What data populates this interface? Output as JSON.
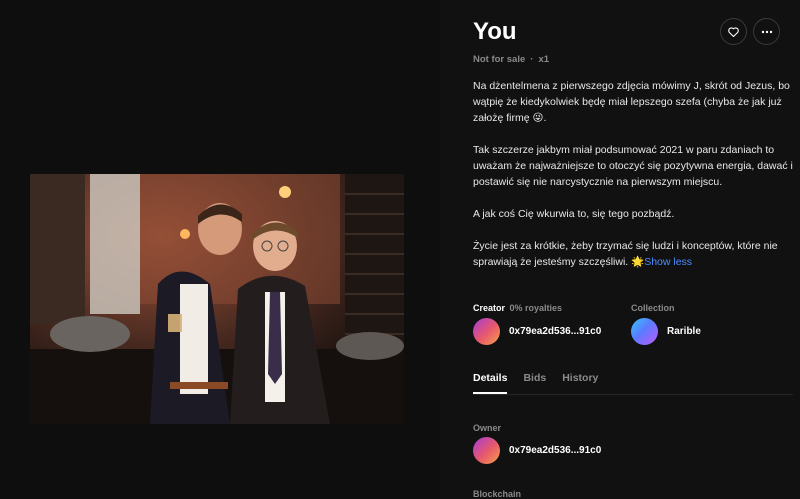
{
  "item": {
    "title": "You",
    "sale_status": "Not for sale",
    "edition": "x1",
    "description": [
      "Na dżentelmena z pierwszego zdjęcia mówimy J, skrót od Jezus, bo wątpię że kiedykolwiek będę miał lepszego szefa (chyba że jak już założę firmę 😜.",
      "Tak szczerze jakbym miał podsumować 2021 w paru zdaniach to uważam że najważniejsze to otoczyć się pozytywna energia, dawać i postawić się nie narcystycznie na pierwszym miejscu.",
      "A jak coś Cię wkurwia to, się tego pozbądź.",
      "Życie jest za krótkie, żeby trzymać się ludzi i konceptów, które nie sprawiają że jesteśmy szczęśliwi. 🌟"
    ],
    "show_less": "Show less"
  },
  "creator": {
    "label": "Creator",
    "royalties": "0% royalties",
    "address": "0x79ea2d536...91c0"
  },
  "collection": {
    "label": "Collection",
    "name": "Rarible"
  },
  "tabs": [
    "Details",
    "Bids",
    "History"
  ],
  "details": {
    "owner_label": "Owner",
    "owner_address": "0x79ea2d536...91c0",
    "blockchain_label": "Blockchain"
  },
  "icons": {
    "like": "heart-icon",
    "more": "more-dots-icon"
  },
  "colors": {
    "accent_link": "#4e8cff",
    "background": "#111111"
  }
}
